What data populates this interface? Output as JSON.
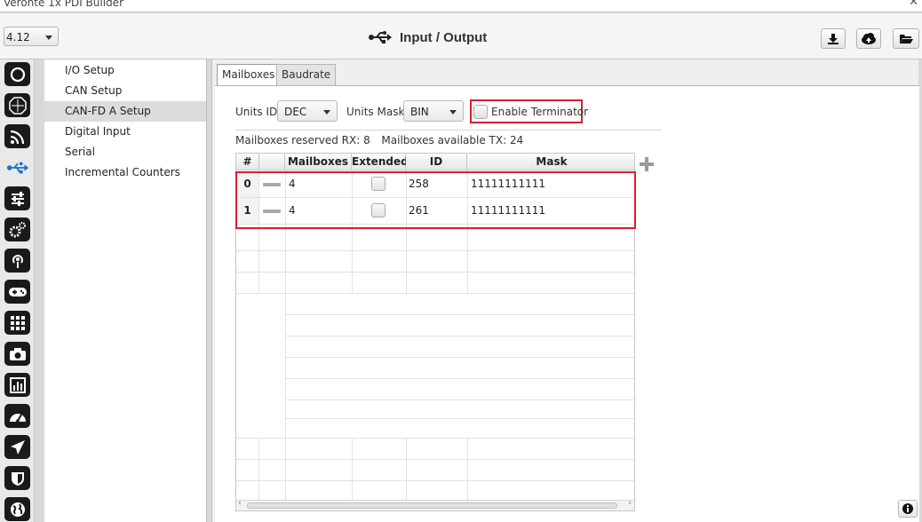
{
  "window": {
    "title": "Veronte 1x PDI Builder"
  },
  "header": {
    "version": "4.12",
    "title": "Input / Output",
    "actions": [
      {
        "icon": "download-icon"
      },
      {
        "icon": "cloud-upload-icon"
      },
      {
        "icon": "folder-open-icon"
      }
    ]
  },
  "rail": {
    "icons": [
      "power-icon",
      "octagon-icon",
      "rss-icon",
      "usb-icon",
      "sliders-icon",
      "gears-icon",
      "podcast-icon",
      "gamepad-icon",
      "grid-icon",
      "camera-icon",
      "bar-chart-icon",
      "gauge-icon",
      "plane-icon",
      "shield-icon",
      "globe-icon"
    ],
    "active": "usb-icon"
  },
  "nav": {
    "items": [
      "I/O Setup",
      "CAN Setup",
      "CAN-FD A Setup",
      "Digital Input",
      "Serial",
      "Incremental Counters"
    ],
    "selected": "CAN-FD A Setup"
  },
  "tabs": [
    "Mailboxes",
    "Baudrate"
  ],
  "selected_tab": "Mailboxes",
  "controls": {
    "units_id_label": "Units ID",
    "units_id_value": "DEC",
    "units_mask_label": "Units Mask",
    "units_mask_value": "BIN",
    "terminator_label": "Enable Terminator",
    "terminator_checked": false
  },
  "stats": {
    "reserved_rx_label": "Mailboxes reserved RX:",
    "reserved_rx_value": "8",
    "available_tx_label": "Mailboxes available TX:",
    "available_tx_value": "24"
  },
  "table": {
    "columns": [
      "#",
      "",
      "Mailboxes",
      "Extended",
      "ID",
      "Mask"
    ],
    "rows": [
      {
        "index": "0",
        "mailboxes": "4",
        "extended": false,
        "id": "258",
        "mask": "11111111111"
      },
      {
        "index": "1",
        "mailboxes": "4",
        "extended": false,
        "id": "261",
        "mask": "11111111111"
      }
    ]
  },
  "colors": {
    "highlight": "#d7202c",
    "icon": "#1a1a1a",
    "accent": "#1a73c7"
  }
}
